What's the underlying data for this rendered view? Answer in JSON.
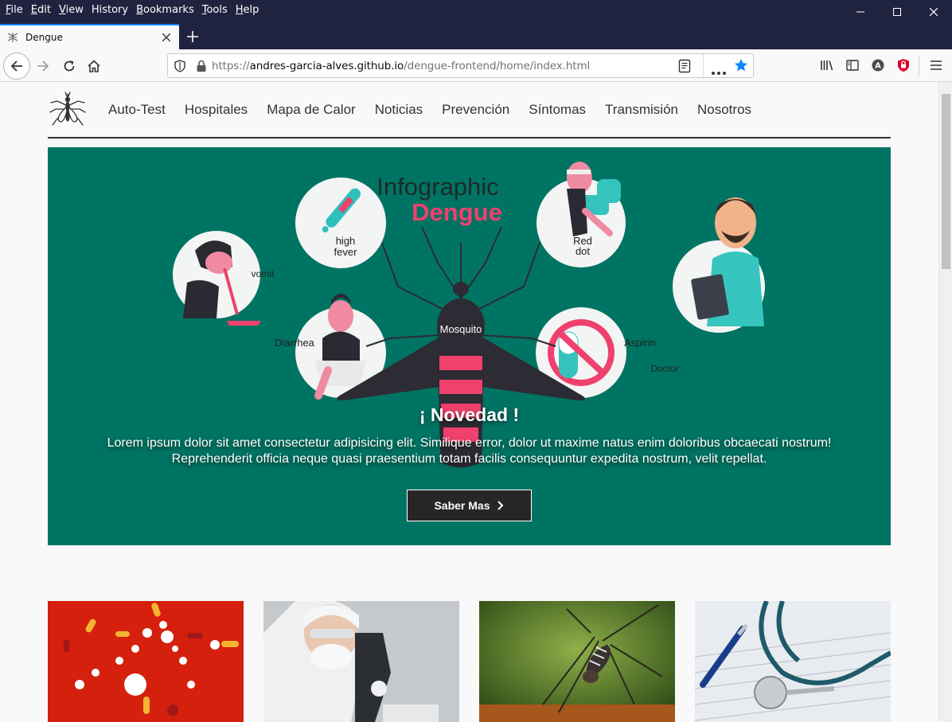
{
  "browser": {
    "menu": [
      "File",
      "Edit",
      "View",
      "History",
      "Bookmarks",
      "Tools",
      "Help"
    ],
    "menu_access_keys": [
      "F",
      "E",
      "V",
      "S",
      "B",
      "T",
      "H"
    ],
    "tab_title": "Dengue",
    "url_prefix": "https://",
    "url_host": "andres-garcia-alves.github.io",
    "url_path": "/dengue-frontend/home/index.html"
  },
  "site": {
    "nav": [
      "Auto-Test",
      "Hospitales",
      "Mapa de Calor",
      "Noticias",
      "Prevención",
      "Síntomas",
      "Transmisión",
      "Nosotros"
    ],
    "hero": {
      "infographic_title_1": "Infographic",
      "infographic_title_2": "Dengue",
      "labels": {
        "high_fever": [
          "high",
          "fever"
        ],
        "vomit": "vomit",
        "red_dot": [
          "Red",
          "dot"
        ],
        "doctor": "Doctor",
        "diarrhea": "Diarrhea",
        "mosquito": "Mosquito",
        "aspirin": "Aspirin"
      },
      "title": "¡ Novedad !",
      "text": "Lorem ipsum dolor sit amet consectetur adipisicing elit. Similique error, dolor ut maxime natus enim doloribus obcaecati nostrum! Reprehenderit officia neque quasi praesentium totam facilis consequuntur expedita nostrum, velit repellat.",
      "button": "Saber Mas"
    }
  },
  "colors": {
    "hero_bg": "#007463",
    "accent_pink": "#f0406e",
    "browser_dark": "#202340",
    "link_blue": "#0a84ff"
  }
}
